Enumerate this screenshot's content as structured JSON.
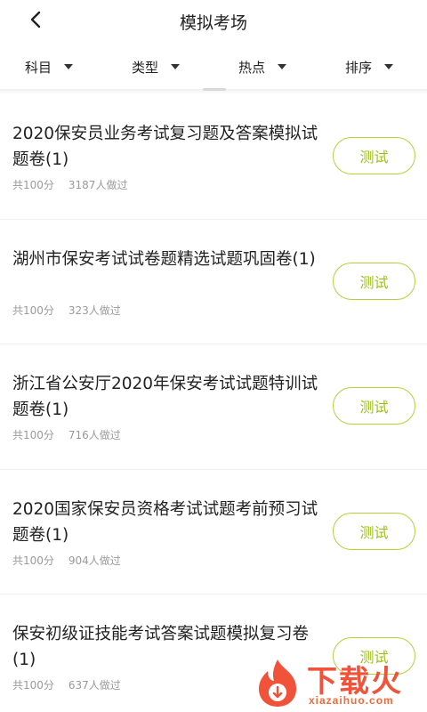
{
  "header": {
    "title": "模拟考场"
  },
  "filters": [
    {
      "label": "科目"
    },
    {
      "label": "类型"
    },
    {
      "label": "热点"
    },
    {
      "label": "排序"
    }
  ],
  "items": [
    {
      "title": "2020保安员业务考试复习题及答案模拟试题卷(1)",
      "score": "共100分",
      "count": "3187人做过",
      "button": "测试"
    },
    {
      "title": "湖州市保安考试试卷题精选试题巩固卷(1)",
      "score": "共100分",
      "count": "323人做过",
      "button": "测试"
    },
    {
      "title": "浙江省公安厅2020年保安考试试题特训试题卷(1)",
      "score": "共100分",
      "count": "716人做过",
      "button": "测试"
    },
    {
      "title": "2020国家保安员资格考试试题考前预习试题卷(1)",
      "score": "共100分",
      "count": "904人做过",
      "button": "测试"
    },
    {
      "title": "保安初级证技能考试答案试题模拟复习卷(1)",
      "score": "共100分",
      "count": "637人做过",
      "button": "测试"
    }
  ],
  "watermark": {
    "text": "下载火",
    "sub": "xiazaihuo.com"
  },
  "colors": {
    "accent_border": "#b7cf3a",
    "accent_text": "#9cbf1f",
    "watermark": "#f0523a"
  }
}
